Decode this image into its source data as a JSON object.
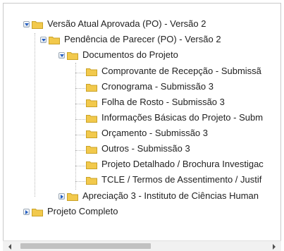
{
  "tree": {
    "root": "Versão Atual Aprovada (PO) - Versão 2",
    "pendencia": "Pendência de Parecer (PO) - Versão 2",
    "documentos": "Documentos do Projeto",
    "docs": [
      "Comprovante de Recepção - Submissã",
      "Cronograma - Submissão 3",
      "Folha de Rosto - Submissão 3",
      "Informações Básicas do Projeto - Subm",
      "Orçamento - Submissão 3",
      "Outros - Submissão 3",
      "Projeto Detalhado / Brochura Investigac",
      "TCLE / Termos de Assentimento / Justif"
    ],
    "apreciacao": "Apreciação 3 - Instituto de Ciências Human",
    "projeto_completo": "Projeto Completo"
  },
  "colors": {
    "folder": "#f2c94c",
    "toggle_arrow": "#245dc1"
  }
}
